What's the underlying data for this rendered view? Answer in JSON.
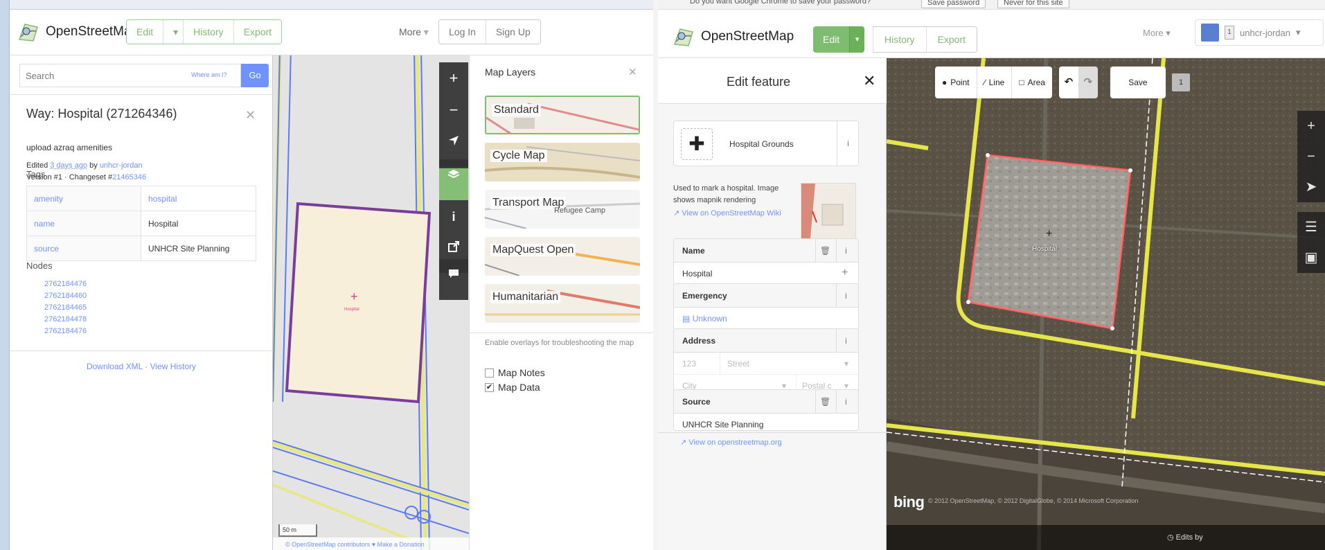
{
  "left": {
    "brand": "OpenStreetMap",
    "tabs": [
      "Edit",
      "History",
      "Export"
    ],
    "more": "More",
    "auth": [
      "Log In",
      "Sign Up"
    ],
    "search": {
      "placeholder": "Search",
      "where_am_i": "Where am I?",
      "go": "Go"
    },
    "way": {
      "title": "Way: Hospital (271264346)",
      "comment": "upload azraq amenities",
      "edited_prefix": "Edited ",
      "edited_ago": "3 days ago",
      "edited_by_prefix": " by ",
      "edited_by": "unhcr-jordan",
      "version_prefix": "Version #1 · Changeset #",
      "changeset": "21465346"
    },
    "tags_heading": "Tags",
    "tags": [
      {
        "key": "amenity",
        "value": "hospital"
      },
      {
        "key": "name",
        "value": "Hospital"
      },
      {
        "key": "source",
        "value": "UNHCR Site Planning"
      }
    ],
    "nodes_heading": "Nodes",
    "nodes": [
      "2762184476",
      "2762184460",
      "2762184465",
      "2762184478",
      "2762184476"
    ],
    "download_xml": "Download XML",
    "view_history": "View History",
    "map_label": "Hospital",
    "layers": {
      "title": "Map Layers",
      "items": [
        "Standard",
        "Cycle Map",
        "Transport Map",
        "MapQuest Open",
        "Humanitarian"
      ],
      "transport_overlay": "Refugee Camp",
      "overlay_note": "Enable overlays for troubleshooting the map",
      "overlays": [
        {
          "label": "Map Notes",
          "checked": false
        },
        {
          "label": "Map Data",
          "checked": true
        }
      ]
    },
    "scale": "50 m",
    "attribution": "© OpenStreetMap contributors ♥ Make a Donation"
  },
  "right": {
    "password_prompt": "Do you want Google Chrome to save your password?",
    "save_password": "Save password",
    "never_for_site": "Never for this site",
    "brand": "OpenStreetMap",
    "edit": "Edit",
    "tabs": [
      "History",
      "Export"
    ],
    "more": "More",
    "user": "unhcr-jordan",
    "user_badge": "1",
    "inspector": {
      "title": "Edit feature",
      "preset": "Hospital Grounds",
      "description": "Used to mark a hospital. Image shows mapnik rendering",
      "view_wiki": "View on OpenStreetMap Wiki",
      "fields": [
        {
          "label": "Name",
          "value": "Hospital"
        },
        {
          "label": "Emergency",
          "value": "Unknown"
        },
        {
          "label": "Address",
          "housenumber": "123",
          "street": "Street",
          "city": "City",
          "postcode": "Postal c"
        },
        {
          "label": "Source",
          "value": "UNHCR Site Planning"
        }
      ],
      "view_on_osm": "View on openstreetmap.org"
    },
    "toolbar": {
      "point": "Point",
      "line": "Line",
      "area": "Area",
      "save": "Save",
      "count": "1"
    },
    "map_label": "Hospital",
    "bing": "bing",
    "attribution": "© 2012 OpenStreetMap, © 2012 DigitalGlobe, © 2014 Microsoft Corporation",
    "edits_by": "Edits by"
  },
  "colors": {
    "osm_green": "#7ebc6f",
    "link_blue": "#7092ff",
    "selection_red": "#ff5a5a",
    "road_yellow": "#e6e64a",
    "area_purple": "#7a3e9a"
  }
}
